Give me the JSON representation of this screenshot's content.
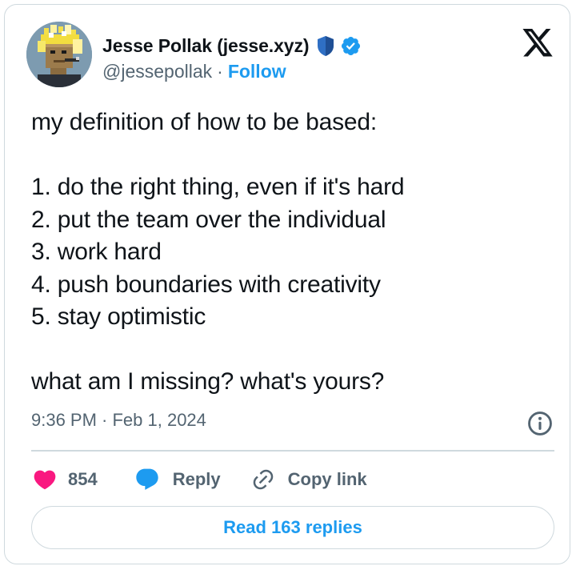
{
  "author": {
    "name": "Jesse Pollak (jesse.xyz)",
    "handle": "@jessepollak",
    "separator": "·",
    "follow_label": "Follow"
  },
  "tweet": {
    "text": "my definition of how to be based:\n\n1. do the right thing, even if it's hard\n2. put the team over the individual\n3. work hard\n4. push boundaries with creativity\n5. stay optimistic\n\nwhat am I missing? what's yours?",
    "timestamp": "9:36 PM · Feb 1, 2024"
  },
  "actions": {
    "like_count": "854",
    "reply_label": "Reply",
    "copy_link_label": "Copy link"
  },
  "footer": {
    "read_replies_label": "Read 163 replies"
  },
  "icons": {
    "shield": "shield-icon",
    "verified": "verified-badge-icon",
    "x_logo": "x-logo-icon",
    "info": "info-icon",
    "like": "heart-icon",
    "reply": "speech-bubble-icon",
    "link": "link-icon"
  },
  "colors": {
    "accent": "#1d9bf0",
    "like": "#f91880",
    "text": "#0f1419",
    "secondary": "#536471",
    "border": "#cfd9de",
    "shield": "#2f6fc4"
  }
}
